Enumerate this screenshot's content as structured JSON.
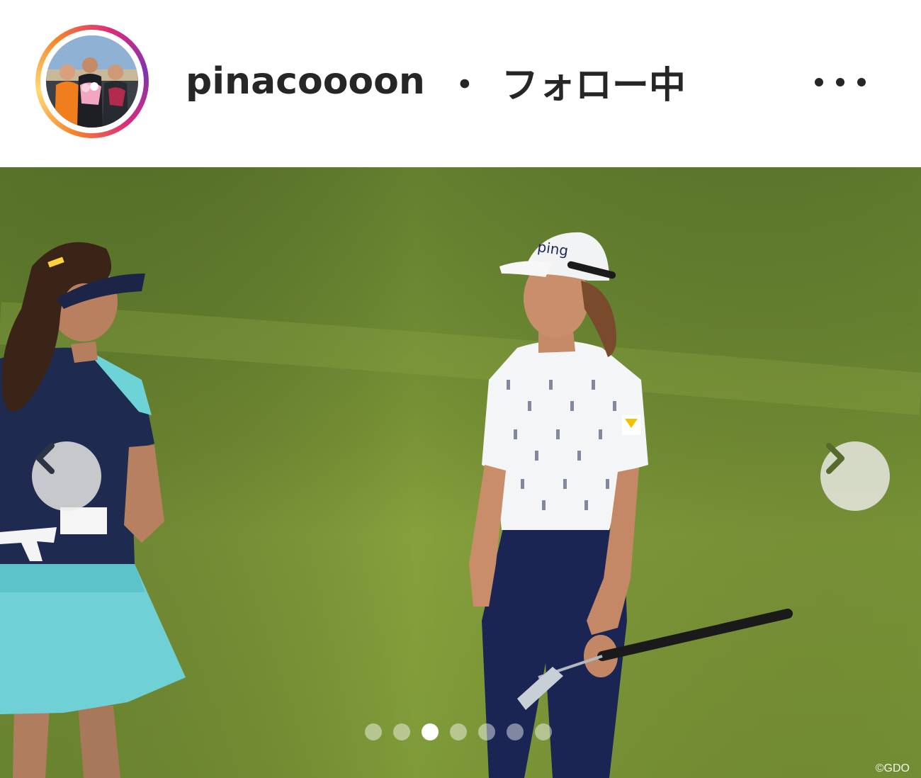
{
  "header": {
    "username": "pinacoooon",
    "separator": "・",
    "follow_status": "フォロー中",
    "more_icon": "more-horizontal-icon"
  },
  "carousel": {
    "slide_count": 7,
    "active_index": 2,
    "prev_icon": "chevron-left-icon",
    "next_icon": "chevron-right-icon"
  },
  "photo": {
    "credit": "©GDO"
  },
  "colors": {
    "ring_orange": "#f58529",
    "ring_pink": "#dd2a7b",
    "text": "#262626",
    "grass": "#7a9436"
  }
}
